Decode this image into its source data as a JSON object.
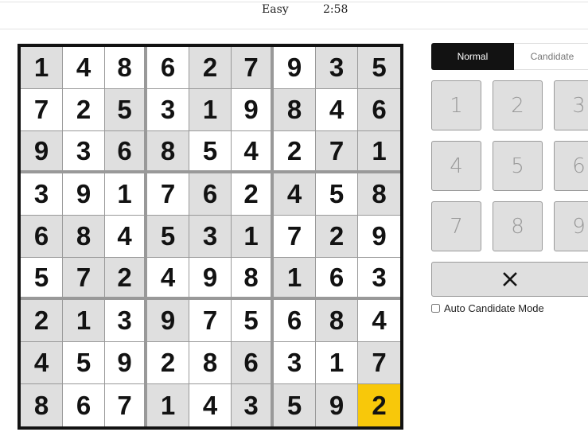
{
  "header": {
    "difficulty": "Easy",
    "timer": "2:58"
  },
  "board": {
    "values": [
      [
        1,
        4,
        8,
        6,
        2,
        7,
        9,
        3,
        5
      ],
      [
        7,
        2,
        5,
        3,
        1,
        9,
        8,
        4,
        6
      ],
      [
        9,
        3,
        6,
        8,
        5,
        4,
        2,
        7,
        1
      ],
      [
        3,
        9,
        1,
        7,
        6,
        2,
        4,
        5,
        8
      ],
      [
        6,
        8,
        4,
        5,
        3,
        1,
        7,
        2,
        9
      ],
      [
        5,
        7,
        2,
        4,
        9,
        8,
        1,
        6,
        3
      ],
      [
        2,
        1,
        3,
        9,
        7,
        5,
        6,
        8,
        4
      ],
      [
        4,
        5,
        9,
        2,
        8,
        6,
        3,
        1,
        7
      ],
      [
        8,
        6,
        7,
        1,
        4,
        3,
        5,
        9,
        2
      ]
    ],
    "shading": [
      "GWWWGGWGG",
      "WWGWGWGWG",
      "GWGGWWWGG",
      "WWWWGWGWG",
      "GGWGGGWGW",
      "WGGWWWGWW",
      "GGWGWWWGW",
      "GWWWWGWWG",
      "GWWGWGGGY"
    ],
    "selected_cell": {
      "row": 9,
      "col": 9
    },
    "colors": {
      "given": "#dfdfdf",
      "filled": "#ffffff",
      "selected": "#f8c80a"
    }
  },
  "panel": {
    "mode_tabs": [
      {
        "label": "Normal",
        "active": true
      },
      {
        "label": "Candidate",
        "active": false
      }
    ],
    "number_keys": [
      "1",
      "2",
      "3",
      "4",
      "5",
      "6",
      "7",
      "8",
      "9"
    ],
    "erase_icon": "close-x-icon",
    "auto_candidate": {
      "label": "Auto Candidate Mode",
      "checked": false
    }
  }
}
